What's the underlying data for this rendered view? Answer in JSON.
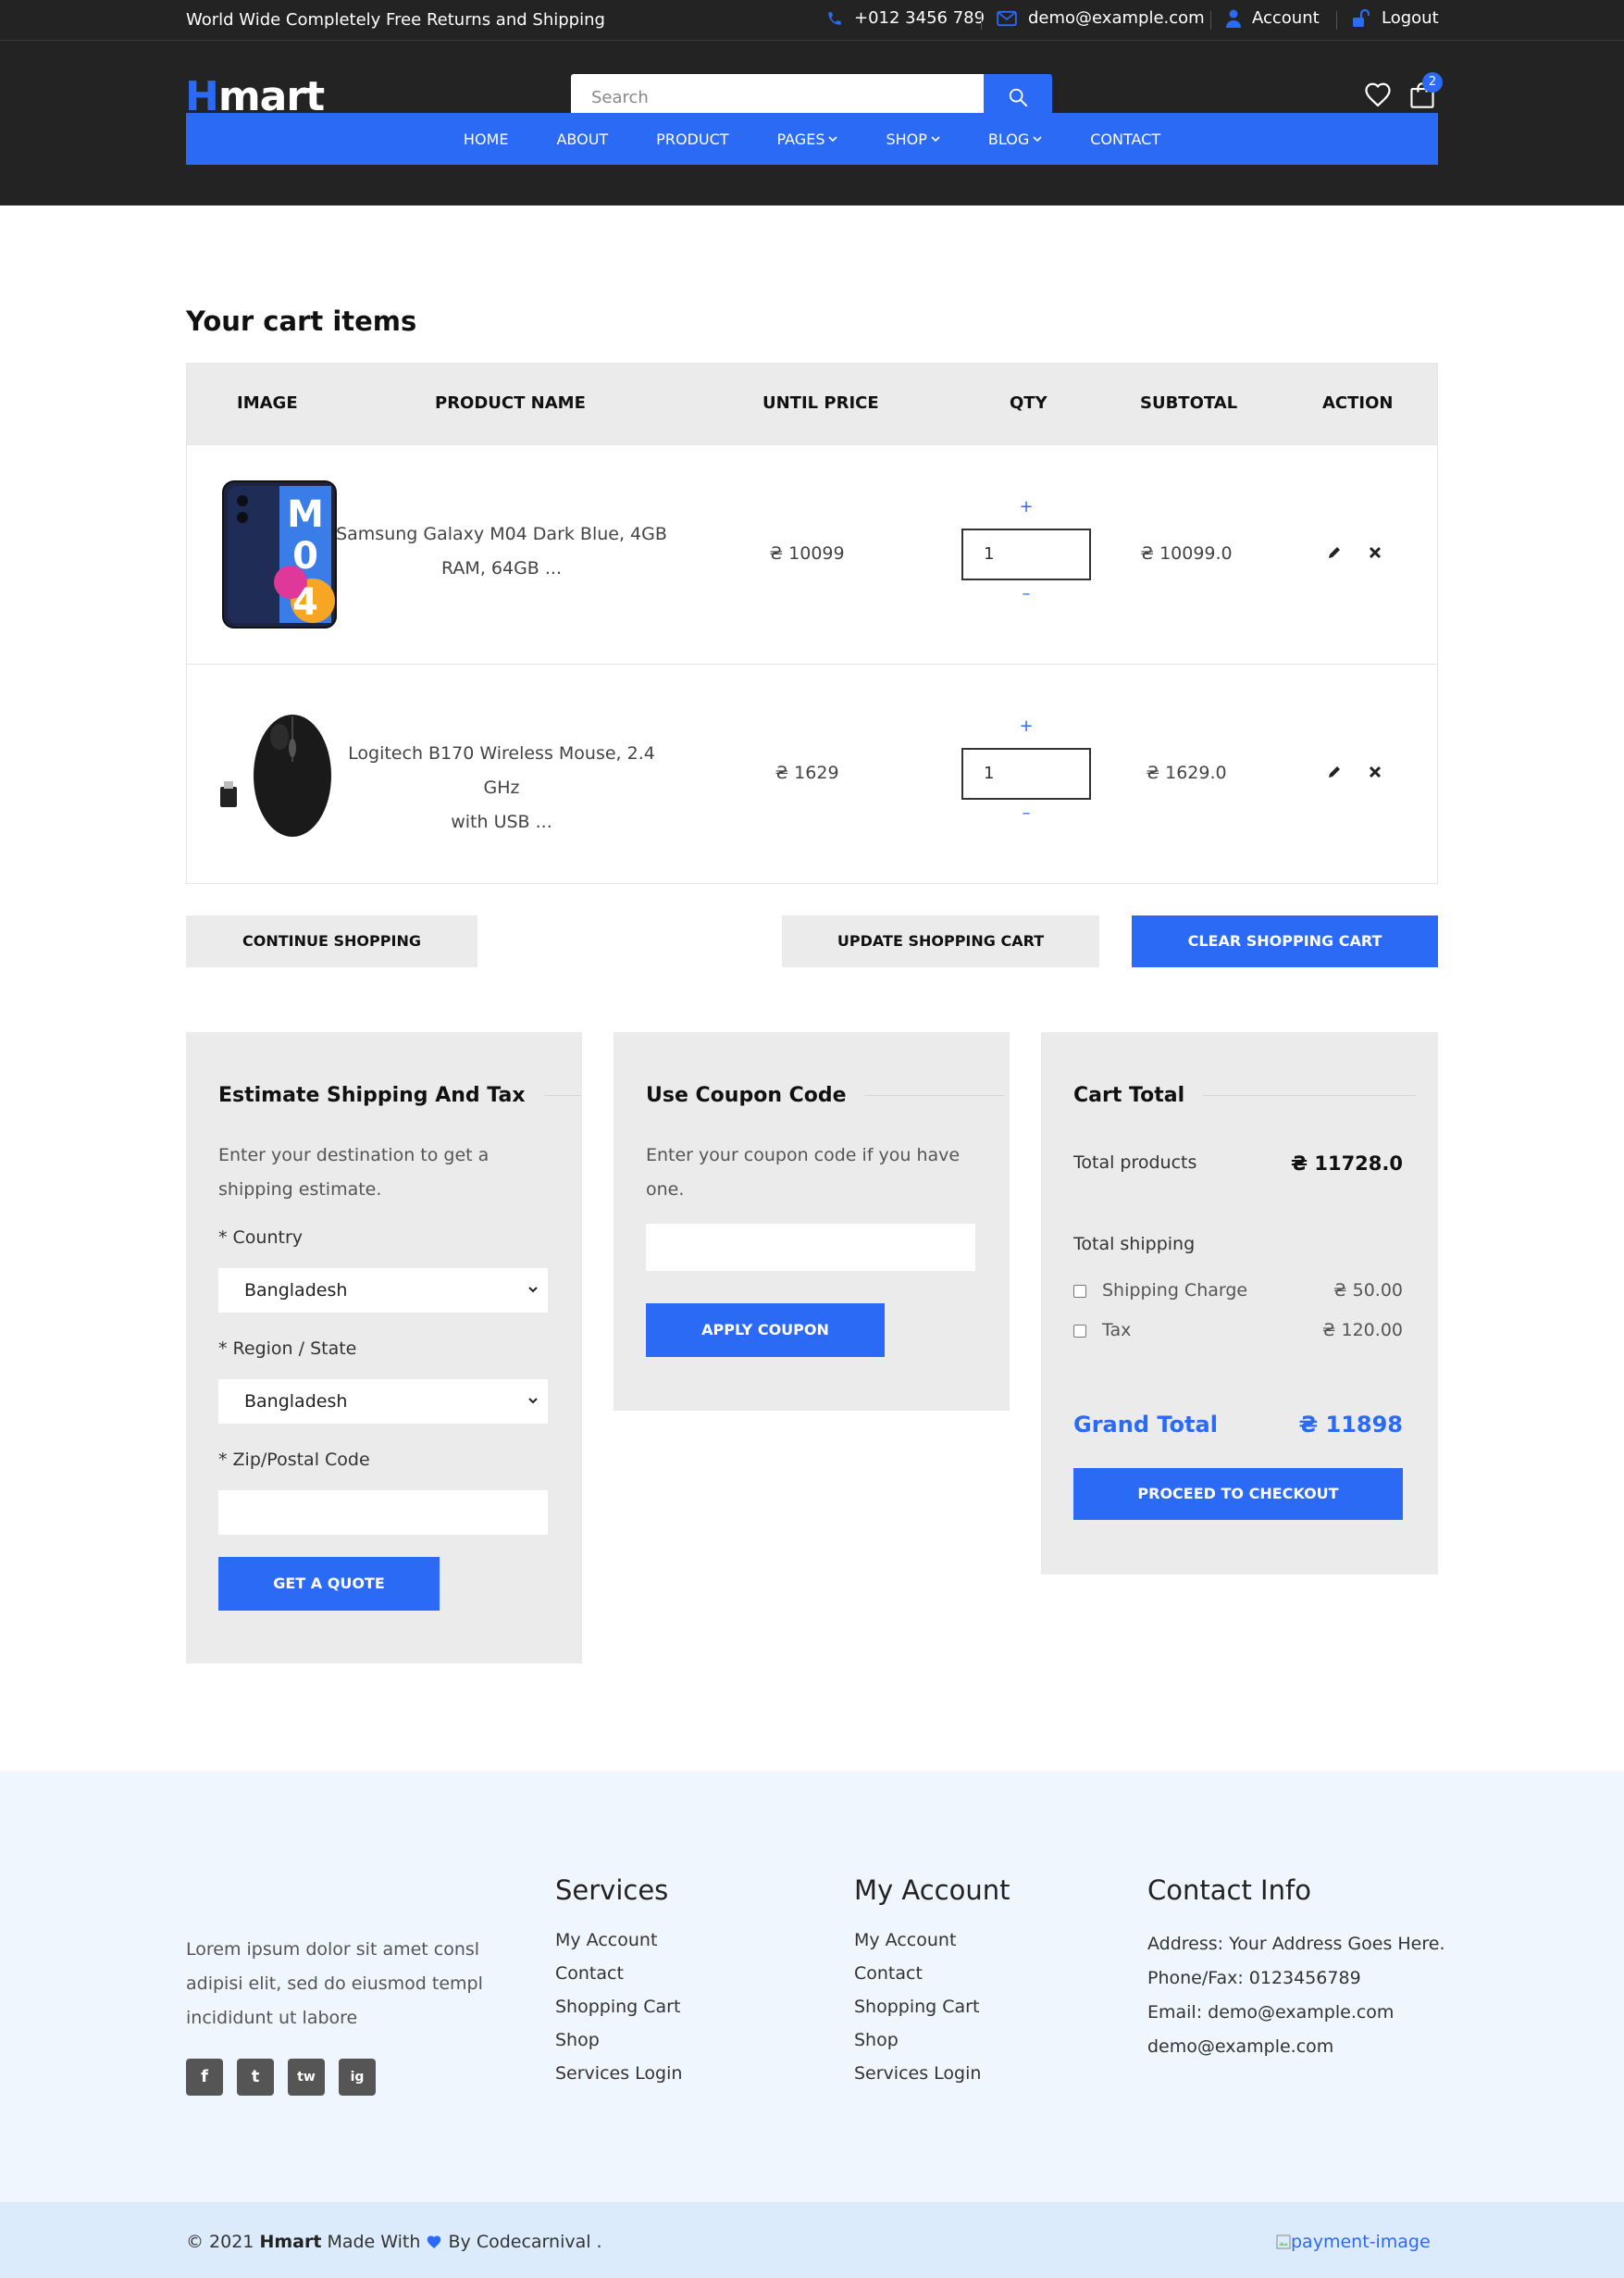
{
  "topbar": {
    "promo": "World Wide Completely Free Returns and Shipping",
    "phone": "+012 3456 789",
    "email": "demo@example.com",
    "account": "Account",
    "logout": "Logout"
  },
  "header": {
    "logo_h": "H",
    "logo_rest": "mart",
    "search_placeholder": "Search",
    "cart_count": "2"
  },
  "nav": {
    "items": [
      "HOME",
      "ABOUT",
      "PRODUCT",
      "PAGES",
      "SHOP",
      "BLOG",
      "CONTACT"
    ]
  },
  "cart": {
    "title": "Your cart items",
    "columns": [
      "IMAGE",
      "PRODUCT NAME",
      "UNTIL PRICE",
      "QTY",
      "SUBTOTAL",
      "ACTION"
    ],
    "rows": [
      {
        "name_line1": "Samsung Galaxy M04 Dark Blue, 4GB",
        "name_line2": "RAM, 64GB ...",
        "price": "₴ 10099",
        "qty": "1",
        "subtotal": "₴ 10099.0",
        "image_text": "M04"
      },
      {
        "name_line1": "Logitech B170 Wireless Mouse, 2.4 GHz",
        "name_line2": "with USB ...",
        "price": "₴ 1629",
        "qty": "1",
        "subtotal": "₴ 1629.0"
      }
    ],
    "qty_plus": "+",
    "qty_minus": "–",
    "continue_label": "CONTINUE SHOPPING",
    "update_label": "UPDATE SHOPPING CART",
    "clear_label": "CLEAR SHOPPING CART"
  },
  "shipping": {
    "title": "Estimate Shipping And Tax",
    "desc_line1": "Enter your destination to get a",
    "desc_line2": "shipping estimate.",
    "country_label": "* Country",
    "country_value": "Bangladesh",
    "region_label": "* Region / State",
    "region_value": "Bangladesh",
    "zip_label": "* Zip/Postal Code",
    "button": "GET A QUOTE"
  },
  "coupon": {
    "title": "Use Coupon Code",
    "desc_line1": "Enter your coupon code if you have",
    "desc_line2": "one.",
    "button": "APPLY COUPON"
  },
  "totals": {
    "title": "Cart Total",
    "products_label": "Total products",
    "products_value": "₴ 11728.0",
    "shipping_label": "Total shipping",
    "charge_label": "Shipping Charge",
    "charge_value": "₴ 50.00",
    "tax_label": "Tax",
    "tax_value": "₴ 120.00",
    "grand_label": "Grand Total",
    "grand_value": "₴ 11898",
    "checkout": "PROCEED TO CHECKOUT"
  },
  "footer": {
    "about_line1": "Lorem ipsum dolor sit amet consl",
    "about_line2": "adipisi elit, sed do eiusmod templ",
    "about_line3": "incididunt ut labore",
    "social": [
      "f",
      "t",
      "tw",
      "ig"
    ],
    "services_title": "Services",
    "services": [
      "My Account",
      "Contact",
      "Shopping Cart",
      "Shop",
      "Services Login"
    ],
    "account_title": "My Account",
    "account_links": [
      "My Account",
      "Contact",
      "Shopping Cart",
      "Shop",
      "Services Login"
    ],
    "contact_title": "Contact Info",
    "contact": [
      "Address: Your Address Goes Here.",
      "Phone/Fax: 0123456789",
      "Email: demo@example.com",
      "demo@example.com"
    ]
  },
  "copyright": {
    "prefix": "© 2021 ",
    "brand": "Hmart",
    "made": " Made With ",
    "by": " By Codecarnival .",
    "payment_alt": "payment-image"
  }
}
